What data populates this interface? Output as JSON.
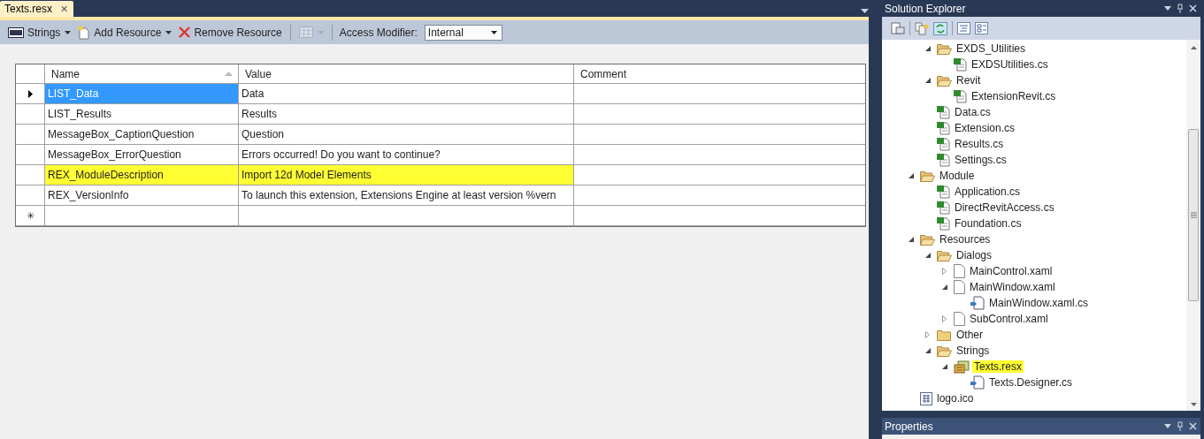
{
  "editor": {
    "tab": {
      "title": "Texts.resx",
      "close": "✕",
      "selected": true
    },
    "toolbar": [
      {
        "kind": "strings",
        "label": "Strings",
        "disabled": false
      },
      {
        "kind": "add",
        "label": "Add Resource",
        "disabled": false
      },
      {
        "kind": "remove",
        "label": "Remove Resource",
        "disabled": false
      },
      {
        "kind": "view",
        "disabled": true
      }
    ],
    "access_modifier": {
      "label": "Access Modifier:",
      "value": "Internal"
    },
    "grid": {
      "columns": [
        "Name",
        "Value",
        "Comment"
      ],
      "rows": [
        {
          "name": "LIST_Data",
          "value": "Data",
          "selected": true,
          "highlighted": false
        },
        {
          "name": "LIST_Results",
          "value": "Results",
          "selected": false,
          "highlighted": false
        },
        {
          "name": "MessageBox_CaptionQuestion",
          "value": "Question",
          "selected": false,
          "highlighted": false
        },
        {
          "name": "MessageBox_ErrorQuestion",
          "value": "Errors occurred! Do you want to continue?",
          "selected": false,
          "highlighted": false
        },
        {
          "name": "REX_ModuleDescription",
          "value": "Import 12d Model Elements",
          "selected": false,
          "highlighted": true
        },
        {
          "name": "REX_VersionInfo",
          "value": "To launch this extension, Extensions Engine at least version %vern",
          "selected": false,
          "highlighted": false
        }
      ],
      "new_row_marker": "✳"
    }
  },
  "solution_explorer": {
    "title": "Solution Explorer",
    "continued_items": [
      {
        "label": "EXDS_Utilities",
        "kind": "folder",
        "expanded": true,
        "highlighted": false,
        "children": [
          {
            "label": "EXDSUtilities.cs",
            "kind": "cs",
            "highlighted": false
          }
        ]
      },
      {
        "label": "Revit",
        "kind": "folder",
        "expanded": true,
        "highlighted": false,
        "children": [
          {
            "label": "ExtensionRevit.cs",
            "kind": "cs",
            "highlighted": false
          }
        ]
      },
      {
        "label": "Data.cs",
        "kind": "cs",
        "highlighted": false
      },
      {
        "label": "Extension.cs",
        "kind": "cs",
        "highlighted": false
      },
      {
        "label": "Results.cs",
        "kind": "cs",
        "highlighted": false
      },
      {
        "label": "Settings.cs",
        "kind": "cs",
        "highlighted": false
      }
    ],
    "items": [
      {
        "label": "Module",
        "kind": "folder",
        "expanded": true,
        "highlighted": false,
        "children": [
          {
            "label": "Application.cs",
            "kind": "cs",
            "highlighted": false
          },
          {
            "label": "DirectRevitAccess.cs",
            "kind": "cs",
            "highlighted": false
          },
          {
            "label": "Foundation.cs",
            "kind": "cs",
            "highlighted": false
          }
        ]
      },
      {
        "label": "Resources",
        "kind": "folder",
        "expanded": true,
        "highlighted": false,
        "children": [
          {
            "label": "Dialogs",
            "kind": "folder",
            "expanded": true,
            "highlighted": false,
            "children": [
              {
                "label": "MainControl.xaml",
                "kind": "xaml",
                "expanded": false,
                "highlighted": false
              },
              {
                "label": "MainWindow.xaml",
                "kind": "xaml",
                "expanded": true,
                "highlighted": false,
                "children": [
                  {
                    "label": "MainWindow.xaml.cs",
                    "kind": "codebehind",
                    "highlighted": false
                  }
                ]
              },
              {
                "label": "SubControl.xaml",
                "kind": "xaml",
                "expanded": false,
                "highlighted": false
              }
            ]
          },
          {
            "label": "Other",
            "kind": "folder",
            "expanded": false,
            "highlighted": false
          },
          {
            "label": "Strings",
            "kind": "folder",
            "expanded": true,
            "highlighted": false,
            "children": [
              {
                "label": "Texts.resx",
                "kind": "resx",
                "expanded": true,
                "highlighted": true,
                "children": [
                  {
                    "label": "Texts.Designer.cs",
                    "kind": "codebehind",
                    "highlighted": false
                  }
                ]
              }
            ]
          }
        ]
      },
      {
        "label": "logo.ico",
        "kind": "ico",
        "highlighted": false
      }
    ]
  },
  "properties": {
    "title": "Properties"
  }
}
